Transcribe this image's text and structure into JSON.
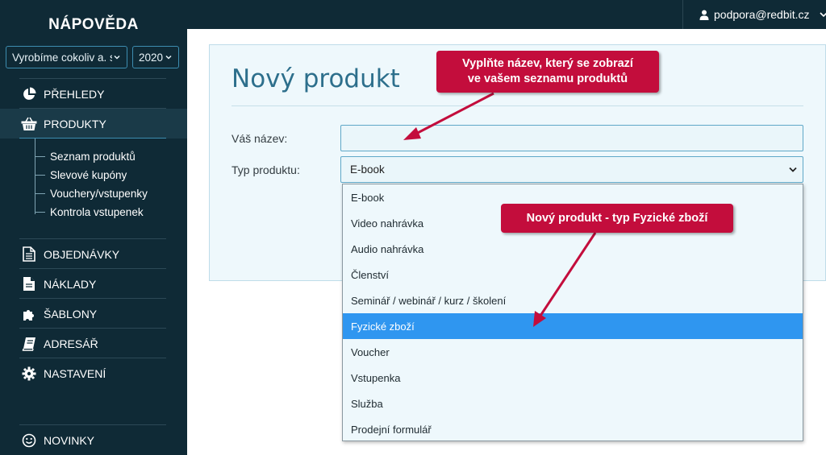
{
  "sidebar": {
    "brand": "NÁPOVĚDA",
    "company_select": "Vyrobíme cokoliv a. s",
    "year_select": "2020",
    "items": [
      {
        "label": "PŘEHLEDY",
        "icon": "pie-chart-icon"
      },
      {
        "label": "PRODUKTY",
        "icon": "basket-icon",
        "active": true
      },
      {
        "label": "OBJEDNÁVKY",
        "icon": "document-icon"
      },
      {
        "label": "NÁKLADY",
        "icon": "file-icon"
      },
      {
        "label": "ŠABLONY",
        "icon": "puzzle-icon"
      },
      {
        "label": "ADRESÁŘ",
        "icon": "book-icon"
      },
      {
        "label": "NASTAVENÍ",
        "icon": "gear-icon"
      },
      {
        "label": "NOVINKY",
        "icon": "smiley-icon"
      }
    ],
    "subitems": [
      "Seznam produktů",
      "Slevové kupóny",
      "Vouchery/vstupenky",
      "Kontrola vstupenek"
    ]
  },
  "header": {
    "user": "podpora@redbit.cz"
  },
  "main": {
    "title": "Nový produkt",
    "name_label": "Váš název:",
    "name_value": "",
    "type_label": "Typ produktu:",
    "type_value": "E-book",
    "options": [
      "E-book",
      "Video nahrávka",
      "Audio nahrávka",
      "Členství",
      "Seminář / webinář / kurz / školení",
      "Fyzické zboží",
      "Voucher",
      "Vstupenka",
      "Služba",
      "Prodejní formulář"
    ],
    "highlighted_option": "Fyzické zboží"
  },
  "callouts": {
    "name_hint_line1": "Vyplňte název, který se zobrazí",
    "name_hint_line2": "ve vašem seznamu produktů",
    "type_hint": "Nový produkt - typ Fyzické zboží"
  },
  "colors": {
    "sidebar_bg": "#0f2a36",
    "accent": "#2d6f8c",
    "highlight": "#2f96f0",
    "callout": "#c30d3c"
  }
}
